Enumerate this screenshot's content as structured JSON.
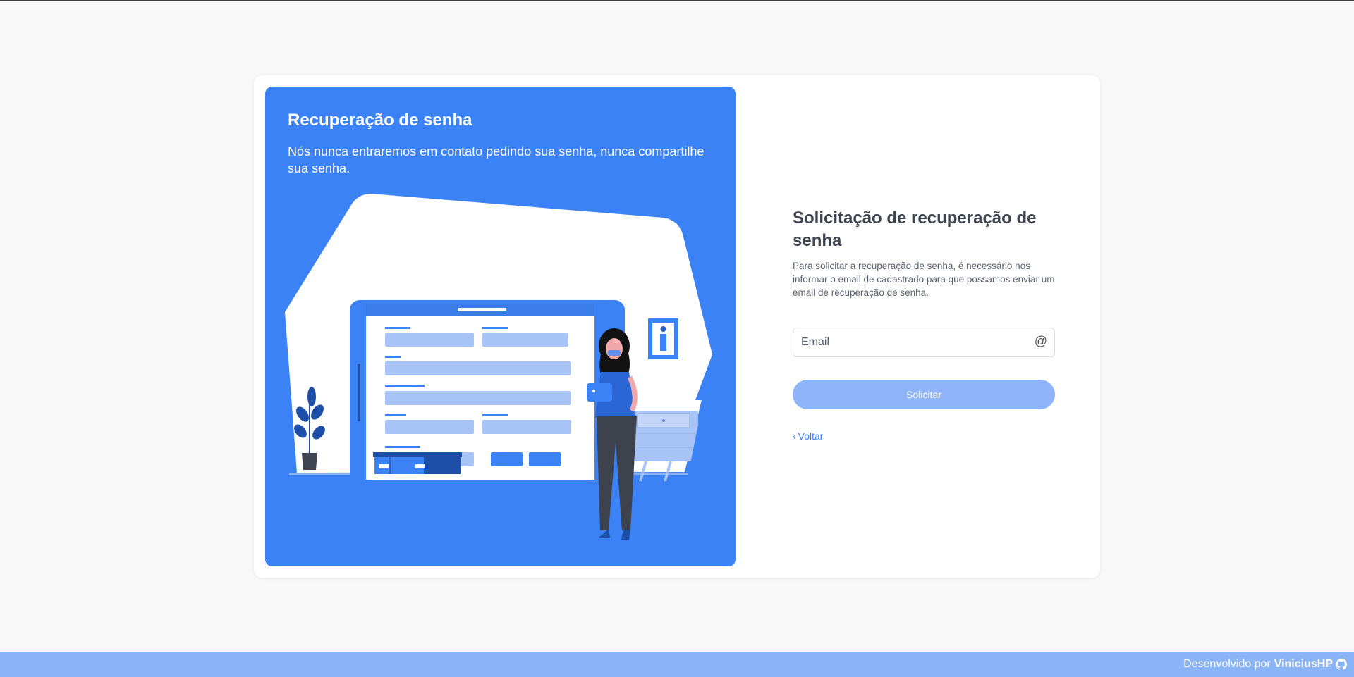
{
  "hero": {
    "title": "Recuperação de senha",
    "subtitle": "Nós nunca entraremos em contato pedindo sua senha, nunca compartilhe sua senha.",
    "background_color": "#3b82f6"
  },
  "form": {
    "title": "Solicitação de recuperação de senha",
    "description": "Para solicitar a recuperação de senha, é necessário nos informar o email de cadastrado para que possamos enviar um email de recuperação de senha.",
    "email_placeholder": "Email",
    "email_value": "",
    "email_icon": "at-icon",
    "submit_label": "Solicitar",
    "back_label": "Voltar",
    "accent_color": "#3b82f6"
  },
  "footer": {
    "prefix": "Desenvolvido por",
    "author": "ViniciusHP",
    "icon": "github-icon",
    "background_color": "#8ab4f8"
  }
}
